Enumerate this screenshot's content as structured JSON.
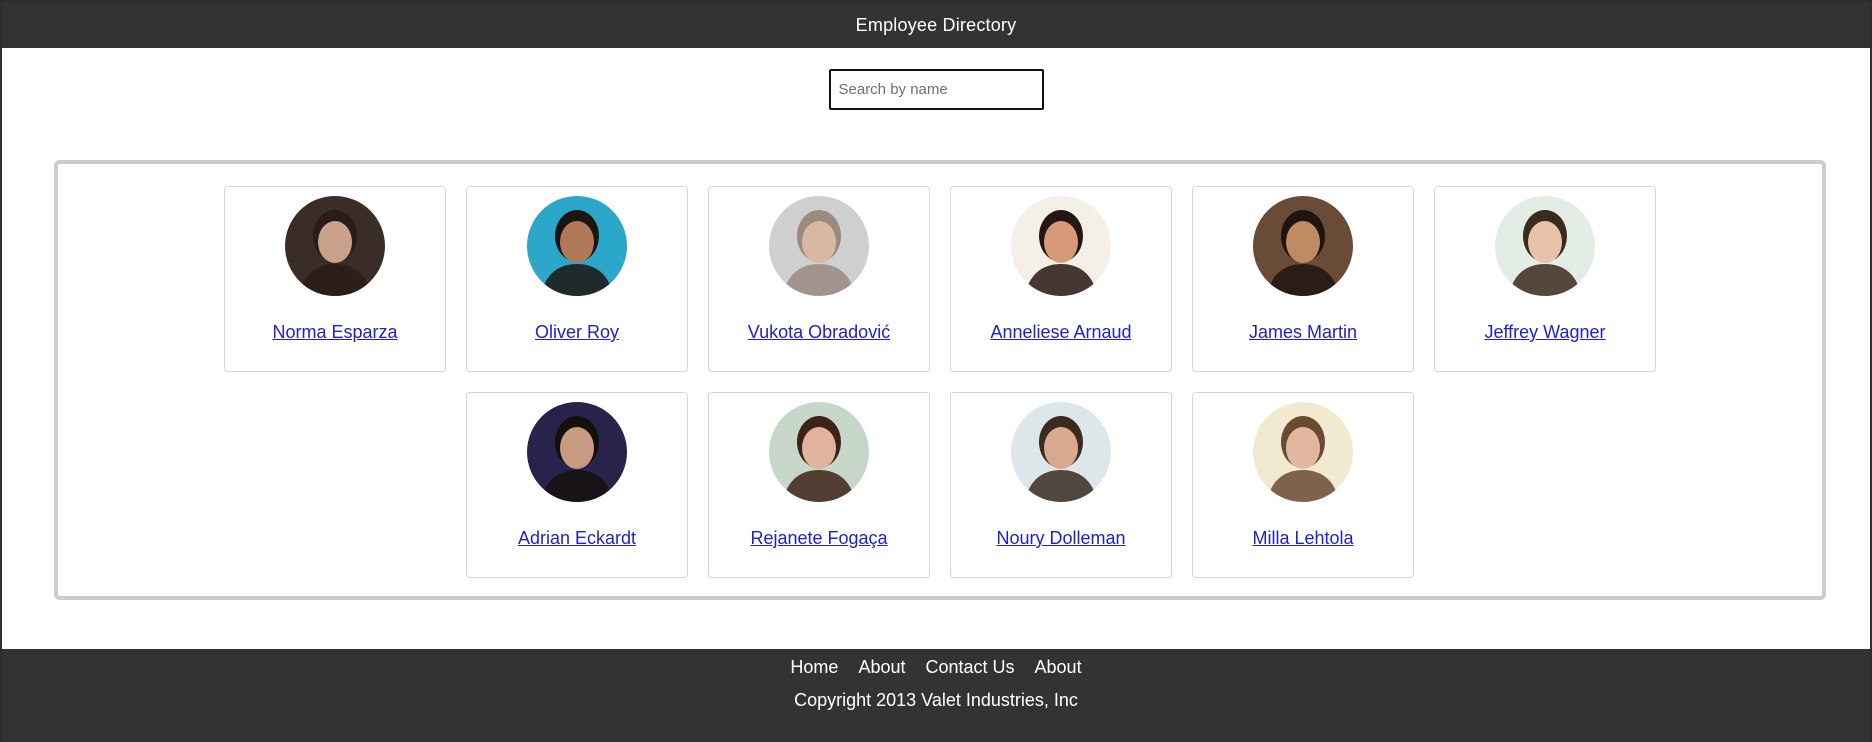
{
  "header": {
    "title": "Employee Directory"
  },
  "search": {
    "placeholder": "Search by name",
    "value": ""
  },
  "employees": [
    {
      "name": "Norma Esparza",
      "avatar_icon": "avatar-photo",
      "bg": "#3a2c26",
      "skin": "#c9a08a",
      "hair": "#2a1d18"
    },
    {
      "name": "Oliver Roy",
      "avatar_icon": "avatar-photo",
      "bg": "#2aa7c9",
      "skin": "#b07a5a",
      "hair": "#1c1410"
    },
    {
      "name": "Vukota Obradović",
      "avatar_icon": "avatar-photo",
      "bg": "#cfcfcf",
      "skin": "#d8b8a4",
      "hair": "#9a8a80"
    },
    {
      "name": "Anneliese Arnaud",
      "avatar_icon": "avatar-photo",
      "bg": "#f4efe7",
      "skin": "#d79a78",
      "hair": "#241614"
    },
    {
      "name": "James Martin",
      "avatar_icon": "avatar-photo",
      "bg": "#6a4b38",
      "skin": "#c08a64",
      "hair": "#1e1410"
    },
    {
      "name": "Jeffrey Wagner",
      "avatar_icon": "avatar-photo",
      "bg": "#e3ece5",
      "skin": "#e7c3aa",
      "hair": "#3b2a1f"
    },
    {
      "name": "Adrian Eckardt",
      "avatar_icon": "avatar-photo",
      "bg": "#27234a",
      "skin": "#c99a82",
      "hair": "#15100e"
    },
    {
      "name": "Rejanete Fogaça",
      "avatar_icon": "avatar-photo",
      "bg": "#c6d6c8",
      "skin": "#e1b39e",
      "hair": "#3d2219"
    },
    {
      "name": "Noury Dolleman",
      "avatar_icon": "avatar-photo",
      "bg": "#dde7ea",
      "skin": "#d8a891",
      "hair": "#3a2a20"
    },
    {
      "name": "Milla Lehtola",
      "avatar_icon": "avatar-photo",
      "bg": "#f2ead0",
      "skin": "#e2b7a0",
      "hair": "#6b4a34"
    }
  ],
  "footer": {
    "nav": [
      {
        "label": "Home"
      },
      {
        "label": "About"
      },
      {
        "label": "Contact Us"
      },
      {
        "label": "About"
      }
    ],
    "copyright": "Copyright 2013 Valet Industries, Inc"
  },
  "colors": {
    "bar_bg": "#333333",
    "link": "#2020cc",
    "card_border": "#d6d6d6",
    "container_border": "#cccccc"
  }
}
